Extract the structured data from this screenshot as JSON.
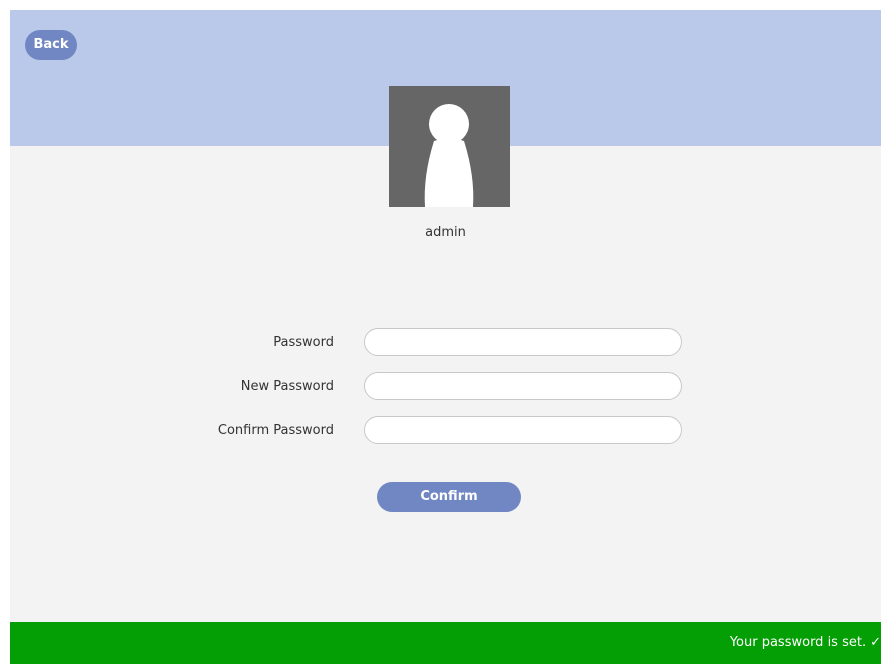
{
  "header": {
    "back_label": "Back"
  },
  "user": {
    "name": "admin",
    "avatar_icon": "user-silhouette-icon"
  },
  "form": {
    "password_label": "Password",
    "password_value": "",
    "new_password_label": "New Password",
    "new_password_value": "",
    "confirm_password_label": "Confirm Password",
    "confirm_password_value": "",
    "confirm_label": "Confirm"
  },
  "status": {
    "message": "Your password is set.",
    "icon": "checkmark-icon",
    "icon_glyph": "✓"
  },
  "colors": {
    "header_bg": "#bac9ea",
    "accent": "#7187c4",
    "status_bg": "#049f04",
    "content_bg": "#f3f3f3"
  }
}
